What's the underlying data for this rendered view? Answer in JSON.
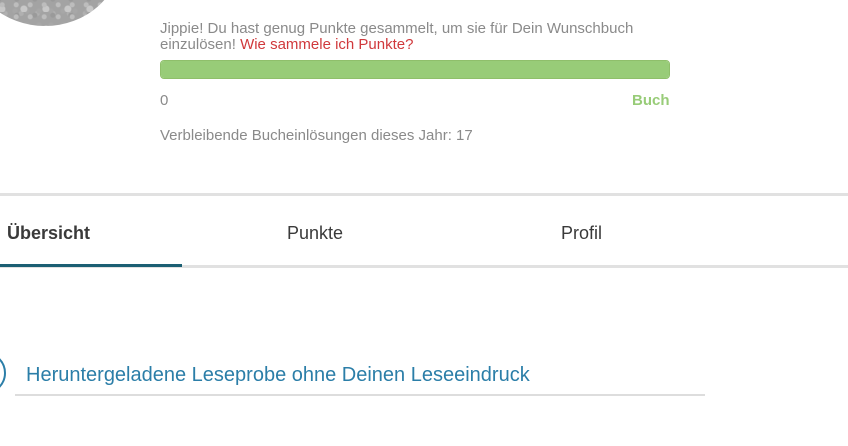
{
  "profile": {
    "message_prefix": "Jippie! Du hast genug Punkte gesammelt, um sie für Dein Wunschbuch einzulösen!",
    "message_link": "Wie sammele ich Punkte?",
    "progress_fraction": 1.0,
    "progress_min_label": "0",
    "progress_max_label": "Buch",
    "remaining_text": "Verbleibende Bucheinlösungen dieses Jahr: 17",
    "colors": {
      "progress": "#98cc78",
      "link": "#d0393c",
      "accent": "#2b7ea8",
      "tab_indicator": "#1b5f73"
    }
  },
  "tabs": [
    {
      "label": "Übersicht",
      "active": true
    },
    {
      "label": "Punkte",
      "active": false
    },
    {
      "label": "Profil",
      "active": false
    }
  ],
  "section": {
    "title": "Heruntergeladene Leseprobe ohne Deinen Leseeindruck"
  }
}
